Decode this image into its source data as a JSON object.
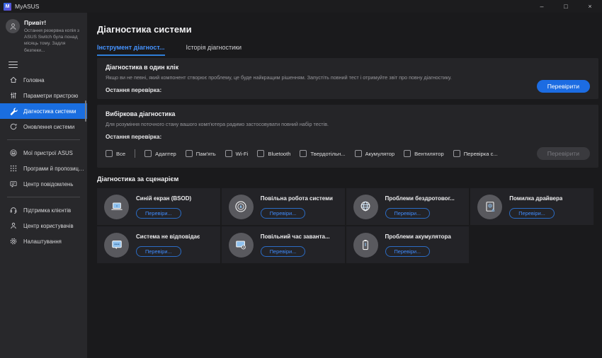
{
  "titlebar": {
    "app_name": "MyASUS",
    "logo_letter": "M",
    "minimize": "–",
    "maximize": "□",
    "close": "×"
  },
  "sidebar": {
    "greeting": {
      "title": "Привіт!",
      "message": "Остання резервна копія з ASUS Switch була понад місяць тому. Задля безпеки..."
    },
    "items": [
      {
        "label": "Головна",
        "icon": "home-icon"
      },
      {
        "label": "Параметри пристрою",
        "icon": "sliders-icon"
      },
      {
        "label": "Діагностика системи",
        "icon": "wrench-icon",
        "selected": true
      },
      {
        "label": "Оновлення системи",
        "icon": "update-icon"
      },
      {
        "label": "Мої пристрої ASUS",
        "icon": "devices-icon"
      },
      {
        "label": "Програми й пропозиції від...",
        "icon": "apps-icon"
      },
      {
        "label": "Центр повідомлень",
        "icon": "messages-icon"
      },
      {
        "label": "Підтримка клієнтів",
        "icon": "support-icon"
      },
      {
        "label": "Центр користувачів",
        "icon": "user-icon"
      },
      {
        "label": "Налаштування",
        "icon": "settings-icon"
      }
    ]
  },
  "main": {
    "page_title": "Діагностика системи",
    "tabs": [
      {
        "label": "Інструмент діагност...",
        "active": true
      },
      {
        "label": "Історія діагностики",
        "active": false
      }
    ],
    "one_click": {
      "title": "Діагностика в один клік",
      "description": "Якщо ви не певні, який компонент створює проблему, це буде найкращим рішенням. Запустіть повний тест і отримуйте звіт про повну діагностику.",
      "last_check_label": "Остання перевірка:",
      "button": "Перевірити"
    },
    "selective": {
      "title": "Вибіркова діагностика",
      "description": "Для розуміння поточного стану вашого комп'ютера радимо застосовувати повний набір тестів.",
      "last_check_label": "Остання перевірка:",
      "checkboxes": [
        "Все",
        "Адаптер",
        "Пам'ять",
        "Wi-Fi",
        "Bluetooth",
        "Твердотільн...",
        "Акумулятор",
        "Вентилятор",
        "Перевірка с..."
      ],
      "button": "Перевірити"
    },
    "scenario": {
      "title": "Діагностика за сценарієм",
      "cards": [
        {
          "title": "Синій екран (BSOD)",
          "icon": "laptop-icon",
          "button": "Перевіри..."
        },
        {
          "title": "Повільна робота системи",
          "icon": "gauge-icon",
          "button": "Перевіри..."
        },
        {
          "title": "Проблеми бездротовог...",
          "icon": "globe-icon",
          "button": "Перевіри..."
        },
        {
          "title": "Помилка драйвера",
          "icon": "driver-icon",
          "button": "Перевіри..."
        },
        {
          "title": "Система не відповідає",
          "icon": "chat-icon",
          "button": "Перевіри..."
        },
        {
          "title": "Повільний час заванта...",
          "icon": "boot-clock-icon",
          "button": "Перевіри..."
        },
        {
          "title": "Проблеми акумулятора",
          "icon": "battery-icon",
          "button": "Перевіри..."
        }
      ]
    }
  },
  "colors": {
    "accent": "#1c6ce2",
    "tab_active": "#4593ff",
    "sidebar_selected": "#1a6ee0",
    "titlebar_bg": "#1c1c1e",
    "sidebar_bg": "#28282b",
    "main_bg": "#1a1a1c",
    "panel_bg": "#252528",
    "card_bg": "#232327",
    "icon_circle_bg": "#59595e",
    "card_glyph": "#9cc6ee"
  }
}
